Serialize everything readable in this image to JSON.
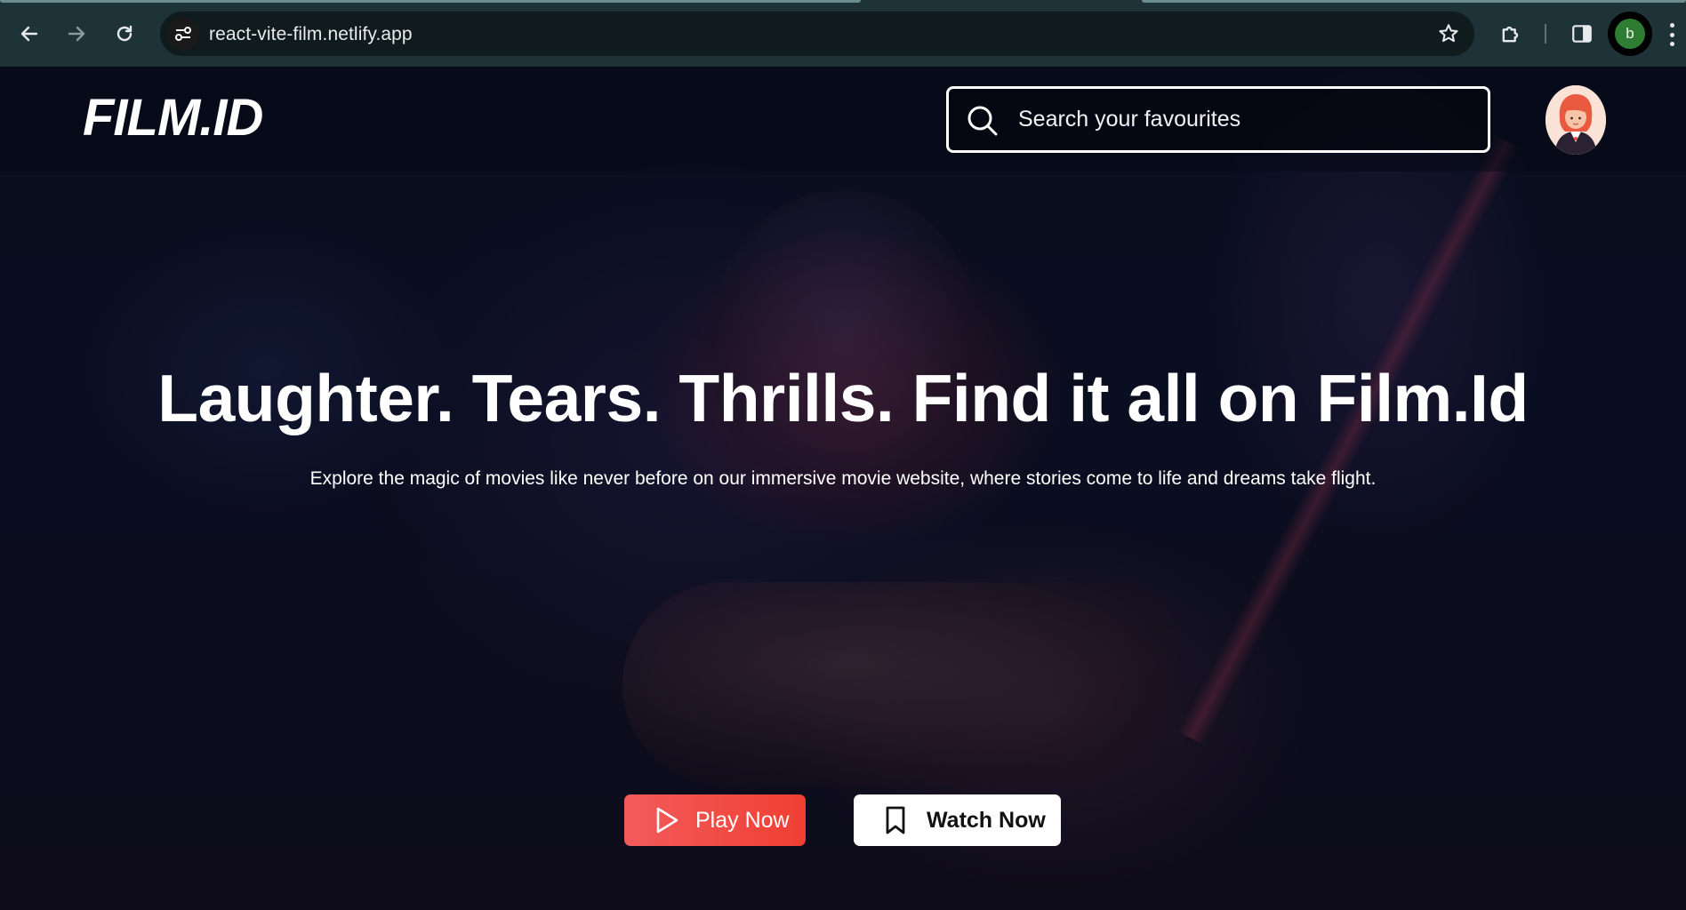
{
  "browser": {
    "url": "react-vite-film.netlify.app",
    "profile_initial": "b",
    "icons": {
      "back": "arrow-left-icon",
      "forward": "arrow-right-icon",
      "reload": "reload-icon",
      "site_info": "tune-icon",
      "bookmark": "star-icon",
      "extensions": "puzzle-icon",
      "side_panel": "side-panel-icon",
      "menu": "kebab-menu-icon"
    }
  },
  "header": {
    "logo": "FILM.ID",
    "search": {
      "placeholder": "Search your favourites",
      "value": ""
    },
    "avatar_icon": "user-avatar"
  },
  "hero": {
    "title": "Laughter. Tears. Thrills. Find it all on Film.Id",
    "subtitle": "Explore the magic of movies like never before on our immersive movie website, where stories come to life and dreams take flight."
  },
  "actions": {
    "play_label": "Play Now",
    "play_icon": "play-icon",
    "watch_label": "Watch Now",
    "watch_icon": "bookmark-icon"
  },
  "colors": {
    "browser_bar": "#1e3338",
    "omnibox": "#0f1b1d",
    "play_button": "#f0453a",
    "watch_button": "#ffffff",
    "profile_badge": "#2e7d32"
  }
}
